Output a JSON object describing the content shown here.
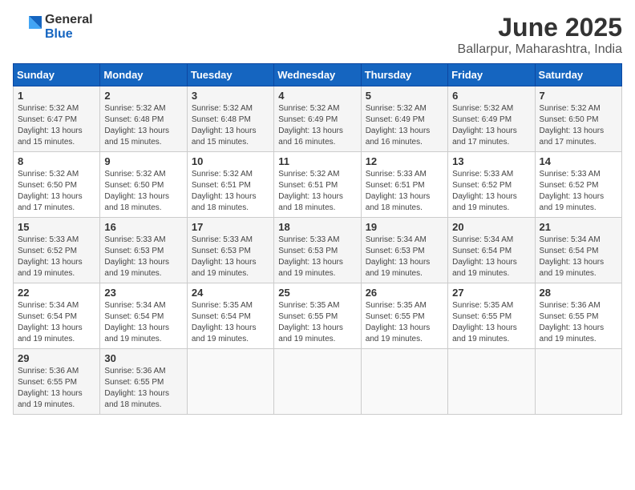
{
  "logo": {
    "general": "General",
    "blue": "Blue"
  },
  "title": {
    "month": "June 2025",
    "location": "Ballarpur, Maharashtra, India"
  },
  "headers": [
    "Sunday",
    "Monday",
    "Tuesday",
    "Wednesday",
    "Thursday",
    "Friday",
    "Saturday"
  ],
  "weeks": [
    [
      {
        "day": "1",
        "sunrise": "5:32 AM",
        "sunset": "6:47 PM",
        "daylight": "13 hours and 15 minutes."
      },
      {
        "day": "2",
        "sunrise": "5:32 AM",
        "sunset": "6:48 PM",
        "daylight": "13 hours and 15 minutes."
      },
      {
        "day": "3",
        "sunrise": "5:32 AM",
        "sunset": "6:48 PM",
        "daylight": "13 hours and 15 minutes."
      },
      {
        "day": "4",
        "sunrise": "5:32 AM",
        "sunset": "6:49 PM",
        "daylight": "13 hours and 16 minutes."
      },
      {
        "day": "5",
        "sunrise": "5:32 AM",
        "sunset": "6:49 PM",
        "daylight": "13 hours and 16 minutes."
      },
      {
        "day": "6",
        "sunrise": "5:32 AM",
        "sunset": "6:49 PM",
        "daylight": "13 hours and 17 minutes."
      },
      {
        "day": "7",
        "sunrise": "5:32 AM",
        "sunset": "6:50 PM",
        "daylight": "13 hours and 17 minutes."
      }
    ],
    [
      {
        "day": "8",
        "sunrise": "5:32 AM",
        "sunset": "6:50 PM",
        "daylight": "13 hours and 17 minutes."
      },
      {
        "day": "9",
        "sunrise": "5:32 AM",
        "sunset": "6:50 PM",
        "daylight": "13 hours and 18 minutes."
      },
      {
        "day": "10",
        "sunrise": "5:32 AM",
        "sunset": "6:51 PM",
        "daylight": "13 hours and 18 minutes."
      },
      {
        "day": "11",
        "sunrise": "5:32 AM",
        "sunset": "6:51 PM",
        "daylight": "13 hours and 18 minutes."
      },
      {
        "day": "12",
        "sunrise": "5:33 AM",
        "sunset": "6:51 PM",
        "daylight": "13 hours and 18 minutes."
      },
      {
        "day": "13",
        "sunrise": "5:33 AM",
        "sunset": "6:52 PM",
        "daylight": "13 hours and 19 minutes."
      },
      {
        "day": "14",
        "sunrise": "5:33 AM",
        "sunset": "6:52 PM",
        "daylight": "13 hours and 19 minutes."
      }
    ],
    [
      {
        "day": "15",
        "sunrise": "5:33 AM",
        "sunset": "6:52 PM",
        "daylight": "13 hours and 19 minutes."
      },
      {
        "day": "16",
        "sunrise": "5:33 AM",
        "sunset": "6:53 PM",
        "daylight": "13 hours and 19 minutes."
      },
      {
        "day": "17",
        "sunrise": "5:33 AM",
        "sunset": "6:53 PM",
        "daylight": "13 hours and 19 minutes."
      },
      {
        "day": "18",
        "sunrise": "5:33 AM",
        "sunset": "6:53 PM",
        "daylight": "13 hours and 19 minutes."
      },
      {
        "day": "19",
        "sunrise": "5:34 AM",
        "sunset": "6:53 PM",
        "daylight": "13 hours and 19 minutes."
      },
      {
        "day": "20",
        "sunrise": "5:34 AM",
        "sunset": "6:54 PM",
        "daylight": "13 hours and 19 minutes."
      },
      {
        "day": "21",
        "sunrise": "5:34 AM",
        "sunset": "6:54 PM",
        "daylight": "13 hours and 19 minutes."
      }
    ],
    [
      {
        "day": "22",
        "sunrise": "5:34 AM",
        "sunset": "6:54 PM",
        "daylight": "13 hours and 19 minutes."
      },
      {
        "day": "23",
        "sunrise": "5:34 AM",
        "sunset": "6:54 PM",
        "daylight": "13 hours and 19 minutes."
      },
      {
        "day": "24",
        "sunrise": "5:35 AM",
        "sunset": "6:54 PM",
        "daylight": "13 hours and 19 minutes."
      },
      {
        "day": "25",
        "sunrise": "5:35 AM",
        "sunset": "6:55 PM",
        "daylight": "13 hours and 19 minutes."
      },
      {
        "day": "26",
        "sunrise": "5:35 AM",
        "sunset": "6:55 PM",
        "daylight": "13 hours and 19 minutes."
      },
      {
        "day": "27",
        "sunrise": "5:35 AM",
        "sunset": "6:55 PM",
        "daylight": "13 hours and 19 minutes."
      },
      {
        "day": "28",
        "sunrise": "5:36 AM",
        "sunset": "6:55 PM",
        "daylight": "13 hours and 19 minutes."
      }
    ],
    [
      {
        "day": "29",
        "sunrise": "5:36 AM",
        "sunset": "6:55 PM",
        "daylight": "13 hours and 19 minutes."
      },
      {
        "day": "30",
        "sunrise": "5:36 AM",
        "sunset": "6:55 PM",
        "daylight": "13 hours and 18 minutes."
      },
      null,
      null,
      null,
      null,
      null
    ]
  ],
  "labels": {
    "sunrise": "Sunrise:",
    "sunset": "Sunset:",
    "daylight": "Daylight:"
  }
}
